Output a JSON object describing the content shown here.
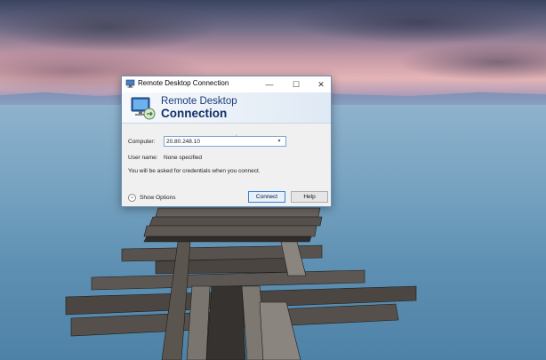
{
  "window": {
    "title": "Remote Desktop Connection",
    "controls": {
      "minimize": "—",
      "maximize": "☐",
      "close": "✕"
    }
  },
  "banner": {
    "line1": "Remote Desktop",
    "line2": "Connection",
    "icon": "remote-desktop-monitor-icon"
  },
  "form": {
    "computer_label": "Computer:",
    "computer_value": "20.80.248.10",
    "username_label": "User name:",
    "username_value": "None specified",
    "credentials_note": "You will be asked for credentials when you connect."
  },
  "footer": {
    "show_options": "Show Options",
    "connect": "Connect",
    "help": "Help"
  },
  "colors": {
    "accent": "#3c7fd1",
    "banner_text": "#12306b"
  }
}
